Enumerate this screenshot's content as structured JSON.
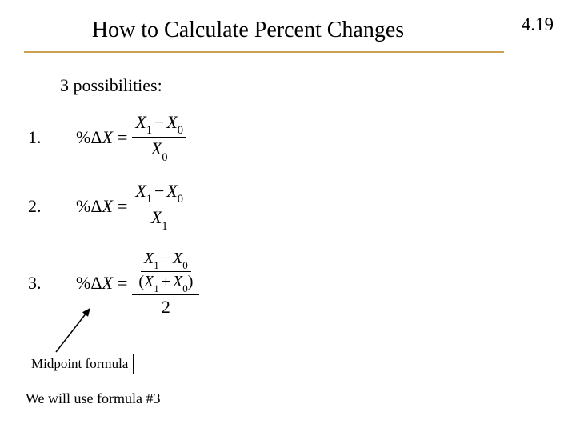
{
  "pageNumber": "4.19",
  "title": "How to Calculate Percent Changes",
  "subtitle": "3 possibilities:",
  "items": [
    {
      "num": "1.",
      "lhs": "%ΔX",
      "numerTop": "X1 − X0",
      "denom": "X0"
    },
    {
      "num": "2.",
      "lhs": "%ΔX",
      "numerTop": "X1 − X0",
      "denom": "X1"
    },
    {
      "num": "3.",
      "lhs": "%ΔX",
      "numerTop": "X1 − X0",
      "denom": "(X1 + X0)",
      "denom2": "2"
    }
  ],
  "boxLabel": "Midpoint formula",
  "footnote": "We will use formula #3",
  "math": {
    "pct": "%",
    "delta": "Δ",
    "X": "X",
    "sub0": "0",
    "sub1": "1",
    "minus": "−",
    "plus": "+",
    "eq": "=",
    "lp": "(",
    "rp": ")",
    "two": "2"
  }
}
